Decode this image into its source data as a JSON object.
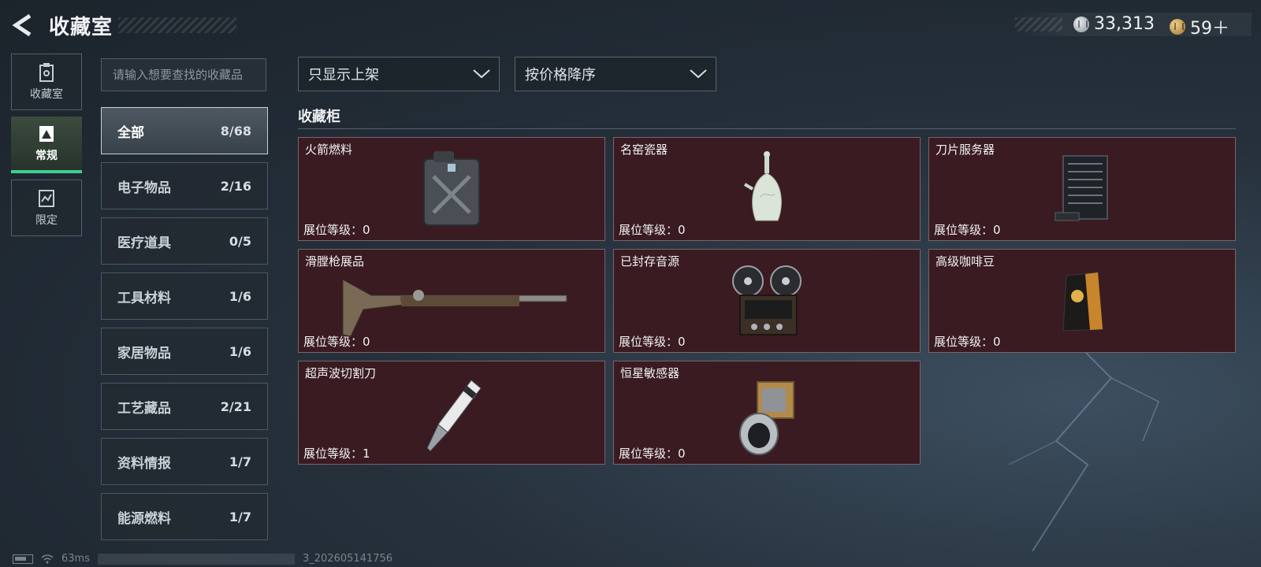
{
  "header": {
    "title": "收藏室",
    "currency": [
      {
        "icon": "silver-coin-icon",
        "value": "33,313"
      },
      {
        "icon": "gold-coin-icon",
        "value": "59＋"
      }
    ]
  },
  "side_nav": {
    "items": [
      {
        "label": "收藏室",
        "icon": "collection-room-icon",
        "active": false
      },
      {
        "label": "常规",
        "icon": "regular-icon",
        "active": true
      },
      {
        "label": "限定",
        "icon": "limited-icon",
        "active": false
      }
    ]
  },
  "search": {
    "placeholder": "请输入想要查找的收藏品"
  },
  "categories": [
    {
      "label": "全部",
      "count": "8/68",
      "active": true
    },
    {
      "label": "电子物品",
      "count": "2/16"
    },
    {
      "label": "医疗道具",
      "count": "0/5"
    },
    {
      "label": "工具材料",
      "count": "1/6"
    },
    {
      "label": "家居物品",
      "count": "1/6"
    },
    {
      "label": "工艺藏品",
      "count": "2/21"
    },
    {
      "label": "资料情报",
      "count": "1/7"
    },
    {
      "label": "能源燃料",
      "count": "1/7"
    }
  ],
  "filters": {
    "filter_value": "只显示上架",
    "sort_value": "按价格降序"
  },
  "cabinet": {
    "title": "收藏柜",
    "items": [
      {
        "name": "火箭燃料",
        "level": "展位等级：0",
        "icon": "fuel-canister-icon"
      },
      {
        "name": "名窑瓷器",
        "level": "展位等级：0",
        "icon": "porcelain-vase-icon"
      },
      {
        "name": "刀片服务器",
        "level": "展位等级：0",
        "icon": "blade-server-icon"
      },
      {
        "name": "滑膛枪展品",
        "level": "展位等级：0",
        "icon": "musket-icon"
      },
      {
        "name": "已封存音源",
        "level": "展位等级：0",
        "icon": "reel-tape-recorder-icon"
      },
      {
        "name": "高级咖啡豆",
        "level": "展位等级：0",
        "icon": "coffee-bag-icon"
      },
      {
        "name": "超声波切割刀",
        "level": "展位等级：1",
        "icon": "ultrasonic-knife-icon"
      },
      {
        "name": "恒星敏感器",
        "level": "展位等级：0",
        "icon": "star-sensor-icon"
      }
    ]
  },
  "status": {
    "ping": "63ms",
    "build": "3_202605141756"
  }
}
